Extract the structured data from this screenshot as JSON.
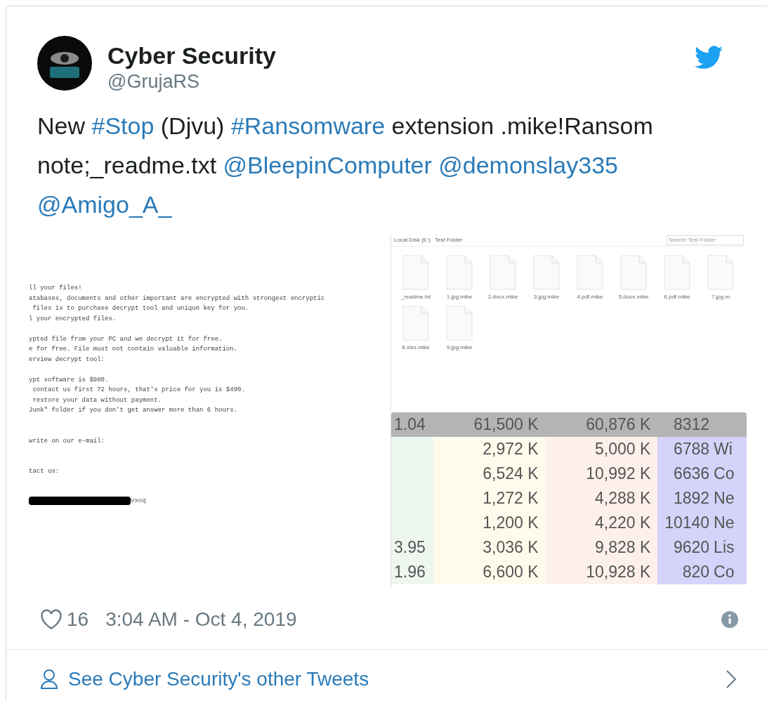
{
  "author": {
    "name": "Cyber Security",
    "handle": "@GrujaRS"
  },
  "tweet": [
    {
      "kind": "text",
      "text": "New "
    },
    {
      "kind": "link",
      "text": "#Stop"
    },
    {
      "kind": "text",
      "text": " (Djvu) "
    },
    {
      "kind": "link",
      "text": "#Ransomware"
    },
    {
      "kind": "text",
      "text": " extension .mike!Ransom note;_readme.txt "
    },
    {
      "kind": "link",
      "text": "@BleepinComputer"
    },
    {
      "kind": "link",
      "text": "@demonslay335"
    },
    {
      "kind": "link",
      "text": "@Amigo_A_"
    }
  ],
  "ransom_note": {
    "lines": [
      {
        "kind": "text",
        "text": "ll your files!"
      },
      {
        "kind": "text",
        "text": "atabases, documents and other important are encrypted with strongest encryptic"
      },
      {
        "kind": "text",
        "text": " files is to purchase decrypt tool and unique key for you."
      },
      {
        "kind": "text",
        "text": "l your encrypted files."
      },
      {
        "kind": "blank"
      },
      {
        "kind": "text",
        "text": "ypted file from your PC and we decrypt it for free."
      },
      {
        "kind": "text",
        "text": "e for free. File must not contain valuable information."
      },
      {
        "kind": "text",
        "text": "erview decrypt tool:"
      },
      {
        "kind": "blank"
      },
      {
        "kind": "text",
        "text": "ypt software is $980."
      },
      {
        "kind": "text",
        "text": " contact us first 72 hours, that's price for you is $490."
      },
      {
        "kind": "text",
        "text": " restore your data without payment."
      },
      {
        "kind": "text",
        "text": "Junk\" folder if you don't get answer more than 6 hours."
      },
      {
        "kind": "blank"
      },
      {
        "kind": "blank"
      },
      {
        "kind": "text",
        "text": "write on our e-mail:"
      },
      {
        "kind": "blank"
      },
      {
        "kind": "blank"
      },
      {
        "kind": "text",
        "text": "tact us:"
      }
    ],
    "redacted_suffix": "vxoq"
  },
  "explorer": {
    "breadcrumb": [
      "Local Disk (E:)",
      "Test Folder"
    ],
    "search_placeholder": "Search Test Folder",
    "files": [
      {
        "name": "_readme.txt"
      },
      {
        "name": "1.jpg.mike"
      },
      {
        "name": "2.docx.mike"
      },
      {
        "name": "3.jpg.mike"
      },
      {
        "name": "4.pdf.mike"
      },
      {
        "name": "5.docx.mike"
      },
      {
        "name": "6.pdf.mike"
      },
      {
        "name": "7.jpg.m"
      },
      {
        "name": "8.xlsx.mike"
      },
      {
        "name": "9.jpg.mike"
      }
    ]
  },
  "process_table": {
    "rows": [
      {
        "selected": true,
        "cells": [
          "1.04",
          "61,500 K",
          "60,876 K",
          "8312",
          null
        ]
      },
      {
        "selected": false,
        "cells": [
          null,
          "2,972 K",
          "5,000 K",
          "6788",
          "Wi"
        ]
      },
      {
        "selected": false,
        "cells": [
          null,
          "6,524 K",
          "10,992 K",
          "6636",
          "Co"
        ]
      },
      {
        "selected": false,
        "cells": [
          null,
          "1,272 K",
          "4,288 K",
          "1892",
          "Ne"
        ]
      },
      {
        "selected": false,
        "cells": [
          null,
          "1,200 K",
          "4,220 K",
          "10140",
          "Ne"
        ]
      },
      {
        "selected": false,
        "cells": [
          "3.95",
          "3,036 K",
          "9,828 K",
          "9620",
          "Lis"
        ]
      },
      {
        "selected": false,
        "cells": [
          "1.96",
          "6,600 K",
          "10,928 K",
          "820",
          "Co"
        ]
      }
    ]
  },
  "footer": {
    "likes": "16",
    "timestamp": "3:04 AM - Oct 4, 2019"
  },
  "more_link": "See Cyber Security's other Tweets"
}
